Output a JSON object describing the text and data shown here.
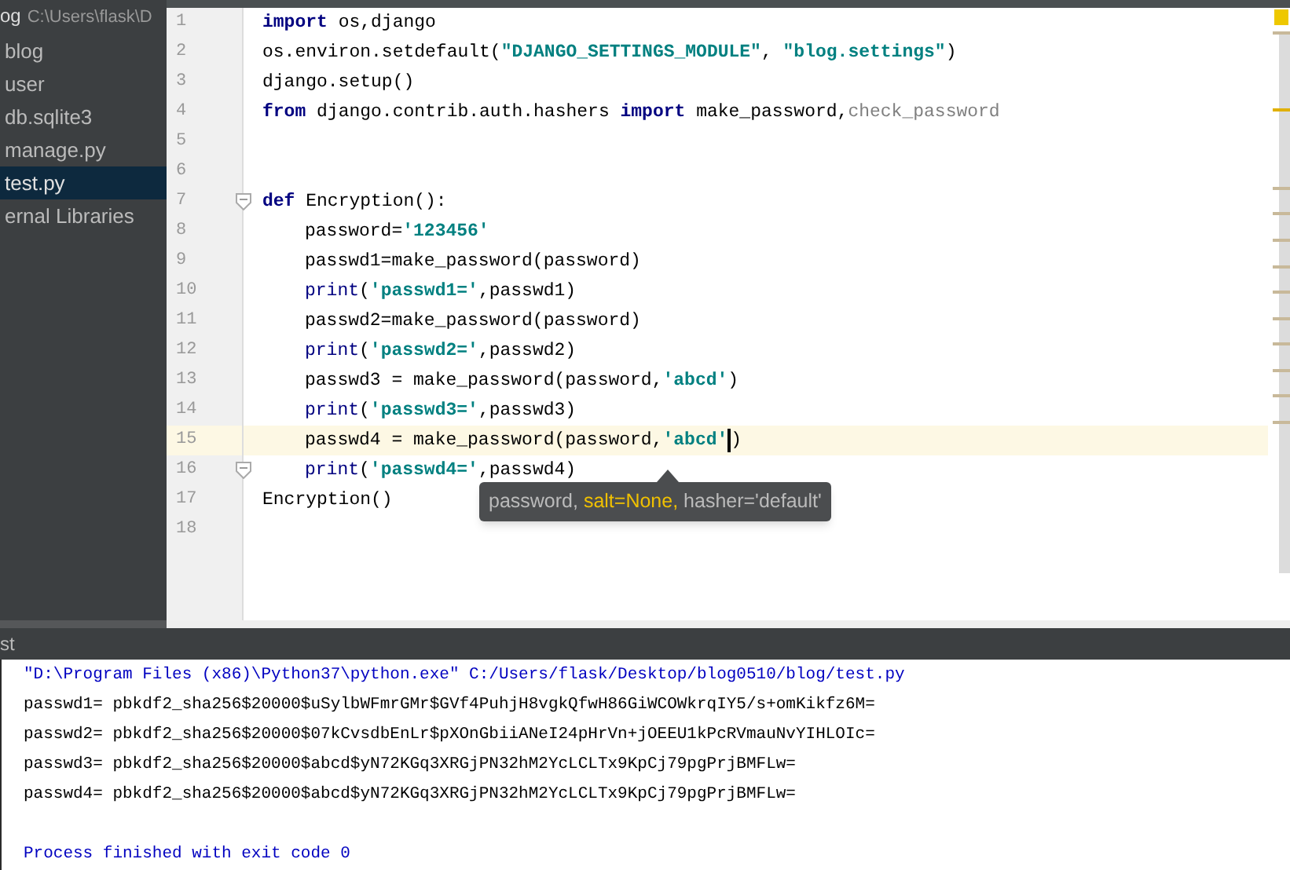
{
  "project": {
    "name": "og",
    "path": "C:\\Users\\flask\\D",
    "items": [
      {
        "label": "blog",
        "selected": false
      },
      {
        "label": "user",
        "selected": false
      },
      {
        "label": "db.sqlite3",
        "selected": false
      },
      {
        "label": "manage.py",
        "selected": false
      },
      {
        "label": "test.py",
        "selected": true
      },
      {
        "label": "ernal Libraries",
        "selected": false
      }
    ]
  },
  "editor": {
    "lines": [
      {
        "number": "1",
        "current": false,
        "fold": false,
        "indented": false,
        "tokens": [
          {
            "kind": "kw",
            "text": "import"
          },
          {
            "kind": "plain",
            "text": " os,django"
          }
        ]
      },
      {
        "number": "2",
        "current": false,
        "fold": false,
        "indented": false,
        "tokens": [
          {
            "kind": "plain",
            "text": "os.environ.setdefault("
          },
          {
            "kind": "str",
            "text": "\"DJANGO_SETTINGS_MODULE\""
          },
          {
            "kind": "plain",
            "text": ", "
          },
          {
            "kind": "str",
            "text": "\"blog.settings\""
          },
          {
            "kind": "plain",
            "text": ")"
          }
        ]
      },
      {
        "number": "3",
        "current": false,
        "fold": false,
        "indented": false,
        "tokens": [
          {
            "kind": "plain",
            "text": "django.setup()"
          }
        ]
      },
      {
        "number": "4",
        "current": false,
        "fold": false,
        "indented": false,
        "tokens": [
          {
            "kind": "kw",
            "text": "from"
          },
          {
            "kind": "plain",
            "text": " django.contrib.auth.hashers "
          },
          {
            "kind": "kw",
            "text": "import"
          },
          {
            "kind": "plain",
            "text": " make_password,"
          },
          {
            "kind": "dim",
            "text": "check_password"
          }
        ]
      },
      {
        "number": "5",
        "current": false,
        "fold": false
      },
      {
        "number": "6",
        "current": false,
        "fold": false
      },
      {
        "number": "7",
        "current": false,
        "fold": true,
        "indented": false,
        "tokens": [
          {
            "kind": "kw",
            "text": "def"
          },
          {
            "kind": "plain",
            "text": " Encryption():"
          }
        ]
      },
      {
        "number": "8",
        "current": false,
        "fold": false,
        "indented": true,
        "tokens": [
          {
            "kind": "plain",
            "text": "password="
          },
          {
            "kind": "str",
            "text": "'123456'"
          }
        ]
      },
      {
        "number": "9",
        "current": false,
        "fold": false,
        "indented": true,
        "tokens": [
          {
            "kind": "plain",
            "text": "passwd1=make_password(password)"
          }
        ]
      },
      {
        "number": "10",
        "current": false,
        "fold": false,
        "indented": true,
        "tokens": [
          {
            "kind": "builtin",
            "text": "print"
          },
          {
            "kind": "plain",
            "text": "("
          },
          {
            "kind": "str",
            "text": "'passwd1='"
          },
          {
            "kind": "plain",
            "text": ",passwd1)"
          }
        ]
      },
      {
        "number": "11",
        "current": false,
        "fold": false,
        "indented": true,
        "tokens": [
          {
            "kind": "plain",
            "text": "passwd2=make_password(password)"
          }
        ]
      },
      {
        "number": "12",
        "current": false,
        "fold": false,
        "indented": true,
        "tokens": [
          {
            "kind": "builtin",
            "text": "print"
          },
          {
            "kind": "plain",
            "text": "("
          },
          {
            "kind": "str",
            "text": "'passwd2='"
          },
          {
            "kind": "plain",
            "text": ",passwd2)"
          }
        ]
      },
      {
        "number": "13",
        "current": false,
        "fold": false,
        "indented": true,
        "tokens": [
          {
            "kind": "plain",
            "text": "passwd3 = make_password(password,"
          },
          {
            "kind": "str",
            "text": "'abcd'"
          },
          {
            "kind": "plain",
            "text": ")"
          }
        ]
      },
      {
        "number": "14",
        "current": false,
        "fold": false,
        "indented": true,
        "tokens": [
          {
            "kind": "builtin",
            "text": "print"
          },
          {
            "kind": "plain",
            "text": "("
          },
          {
            "kind": "str",
            "text": "'passwd3='"
          },
          {
            "kind": "plain",
            "text": ",passwd3)"
          }
        ]
      },
      {
        "number": "15",
        "current": true,
        "fold": false,
        "indented": true,
        "tokens": [
          {
            "kind": "plain",
            "text": "passwd4 = make_password(password,"
          },
          {
            "kind": "str",
            "text": "'abcd'"
          },
          {
            "kind": "plain",
            "text": ")"
          }
        ]
      },
      {
        "number": "16",
        "current": false,
        "fold": true,
        "indented": true,
        "tokens": [
          {
            "kind": "builtin",
            "text": "print"
          },
          {
            "kind": "plain",
            "text": "("
          },
          {
            "kind": "str",
            "text": "'passwd4='"
          },
          {
            "kind": "plain",
            "text": ",passwd4)"
          }
        ]
      },
      {
        "number": "17",
        "current": false,
        "fold": false,
        "indented": false,
        "tokens": [
          {
            "kind": "plain",
            "text": "Encryption()"
          }
        ]
      },
      {
        "number": "18",
        "current": false,
        "fold": false
      }
    ],
    "tooltip": [
      {
        "kind": "param",
        "text": "password, "
      },
      {
        "kind": "current",
        "text": "salt=None,"
      },
      {
        "kind": "param",
        "text": " hasher='default'"
      }
    ]
  },
  "run_panel": {
    "title": "st",
    "lines": [
      {
        "kind": "cmd",
        "text": "\"D:\\Program Files (x86)\\Python37\\python.exe\" C:/Users/flask/Desktop/blog0510/blog/test.py"
      },
      {
        "kind": "out",
        "text": "passwd1= pbkdf2_sha256$20000$uSylbWFmrGMr$GVf4PuhjH8vgkQfwH86GiWCOWkrqIY5/s+omKikfz6M="
      },
      {
        "kind": "out",
        "text": "passwd2= pbkdf2_sha256$20000$07kCvsdbEnLr$pXOnGbiiANeI24pHrVn+jOEEU1kPcRVmauNvYIHLOIc="
      },
      {
        "kind": "out",
        "text": "passwd3= pbkdf2_sha256$20000$abcd$yN72KGq3XRGjPN32hM2YcLCLTx9KpCj79pgPrjBMFLw="
      },
      {
        "kind": "out",
        "text": "passwd4= pbkdf2_sha256$20000$abcd$yN72KGq3XRGjPN32hM2YcLCLTx9KpCj79pgPrjBMFLw="
      },
      {
        "kind": "exit",
        "text": "Process finished with exit code 0"
      }
    ]
  }
}
